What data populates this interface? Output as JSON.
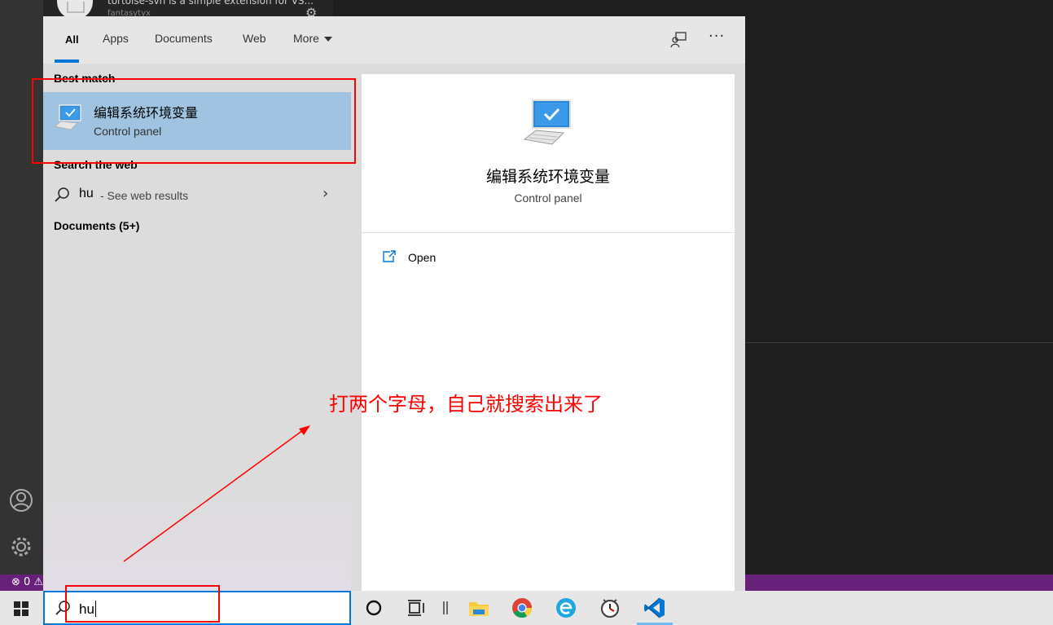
{
  "background_app": {
    "notification_text": "tortoise-svn is a simple extension for VS...",
    "notification_sub": "fantasytyx",
    "status_text": "⊗ 0 ⚠"
  },
  "search": {
    "tabs": [
      {
        "label": "All",
        "active": true
      },
      {
        "label": "Apps"
      },
      {
        "label": "Documents"
      },
      {
        "label": "Web"
      },
      {
        "label": "More"
      }
    ],
    "best_match_heading": "Best match",
    "best_match": {
      "title": "编辑系统环境变量",
      "subtitle": "Control panel"
    },
    "web_heading": "Search the web",
    "web_result": {
      "query": "hu",
      "suffix": " - See web results"
    },
    "documents_heading": "Documents (5+)",
    "preview": {
      "title": "编辑系统环境变量",
      "subtitle": "Control panel",
      "open_label": "Open"
    }
  },
  "taskbar": {
    "search_value": "hu",
    "apps": [
      "cortana-icon",
      "task-view-icon",
      "file-explorer-icon",
      "chrome-icon",
      "browser-e-icon",
      "clock-app-icon",
      "vscode-icon"
    ]
  },
  "annotation": {
    "text": "打两个字母，自己就搜索出来了",
    "color": "#ff0000"
  },
  "colors": {
    "accent": "#0078d7",
    "selection": "#9fc3e0",
    "statusbar": "#68217a"
  }
}
